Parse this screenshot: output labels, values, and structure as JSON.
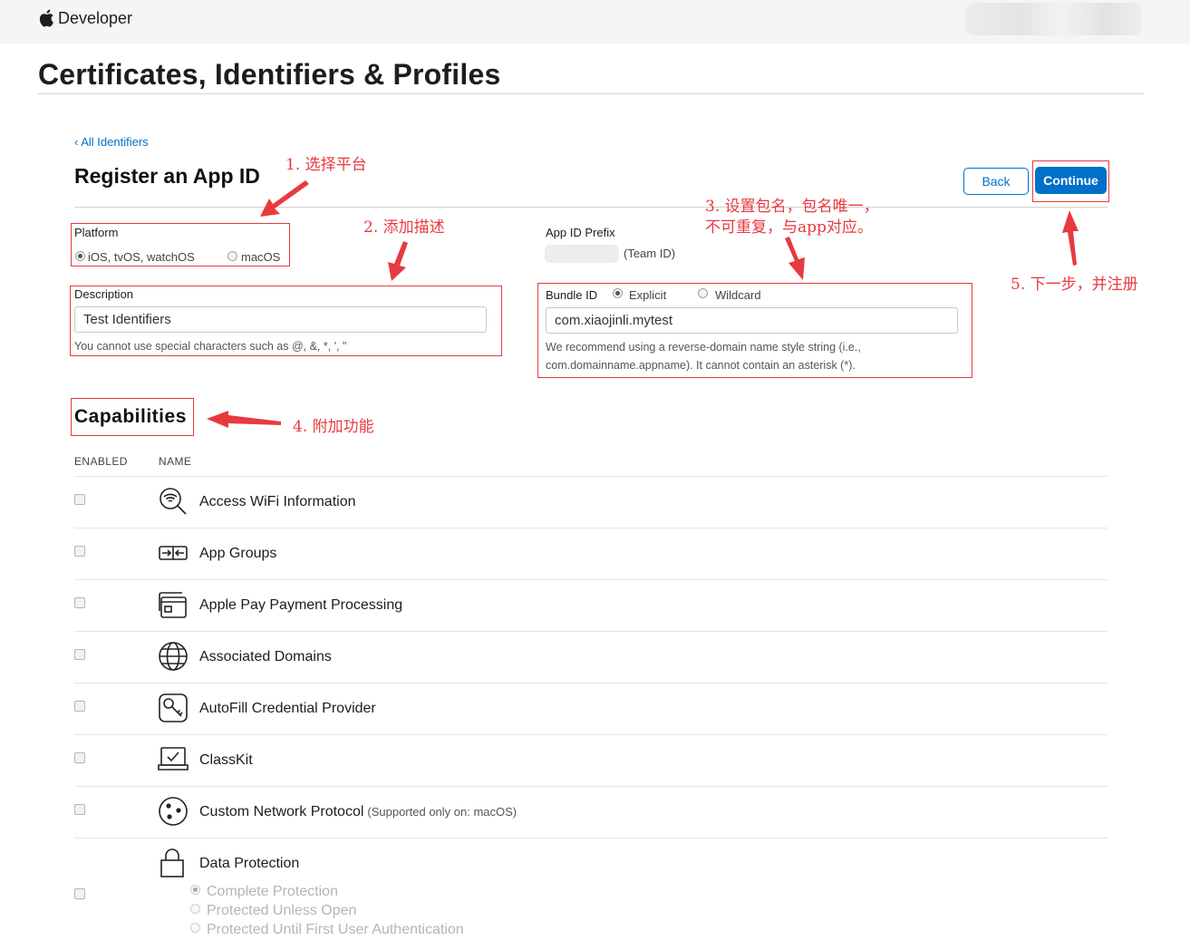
{
  "header": {
    "brand": "Developer"
  },
  "page": {
    "title": "Certificates, Identifiers & Profiles"
  },
  "nav": {
    "back_link": "‹ All Identifiers"
  },
  "section": {
    "title": "Register an App ID"
  },
  "buttons": {
    "back": "Back",
    "continue": "Continue"
  },
  "platform": {
    "label": "Platform",
    "options": [
      {
        "label": "iOS, tvOS, watchOS",
        "selected": true
      },
      {
        "label": "macOS",
        "selected": false
      }
    ]
  },
  "app_id_prefix": {
    "label": "App ID Prefix",
    "suffix": "(Team ID)"
  },
  "description": {
    "label": "Description",
    "value": "Test Identifiers",
    "help": "You cannot use special characters such as @, &, *, ', \""
  },
  "bundle_id": {
    "label": "Bundle ID",
    "options": [
      {
        "label": "Explicit",
        "selected": true
      },
      {
        "label": "Wildcard",
        "selected": false
      }
    ],
    "value": "com.xiaojinli.mytest",
    "help_line1": "We recommend using a reverse-domain name style string (i.e.,",
    "help_line2": "com.domainname.appname). It cannot contain an asterisk (*)."
  },
  "capabilities": {
    "title": "Capabilities",
    "col_enabled": "ENABLED",
    "col_name": "NAME",
    "items": [
      {
        "name": "Access WiFi Information",
        "icon": "wifi-search-icon",
        "enabled": false
      },
      {
        "name": "App Groups",
        "icon": "app-groups-icon",
        "enabled": false
      },
      {
        "name": "Apple Pay Payment Processing",
        "icon": "apple-pay-icon",
        "enabled": false
      },
      {
        "name": "Associated Domains",
        "icon": "globe-icon",
        "enabled": false
      },
      {
        "name": "AutoFill Credential Provider",
        "icon": "key-icon",
        "enabled": false
      },
      {
        "name": "ClassKit",
        "icon": "classkit-icon",
        "enabled": false
      },
      {
        "name": "Custom Network Protocol",
        "note": "(Supported only on: macOS)",
        "icon": "network-protocol-icon",
        "enabled": false
      },
      {
        "name": "Data Protection",
        "icon": "lock-icon",
        "enabled": false,
        "options": [
          "Complete Protection",
          "Protected Unless Open",
          "Protected Until First User Authentication"
        ]
      }
    ]
  },
  "annotations": {
    "a1": "1.  选择平台",
    "a2": "2.  添加描述",
    "a3_line1": "3.  设置包名，包名唯一，",
    "a3_line2": "不可重复，与app对应。",
    "a4": "4.  附加功能",
    "a5": "5.  下一步，并注册"
  },
  "colors": {
    "accent": "#0070c9",
    "annotation": "#e8393f"
  }
}
